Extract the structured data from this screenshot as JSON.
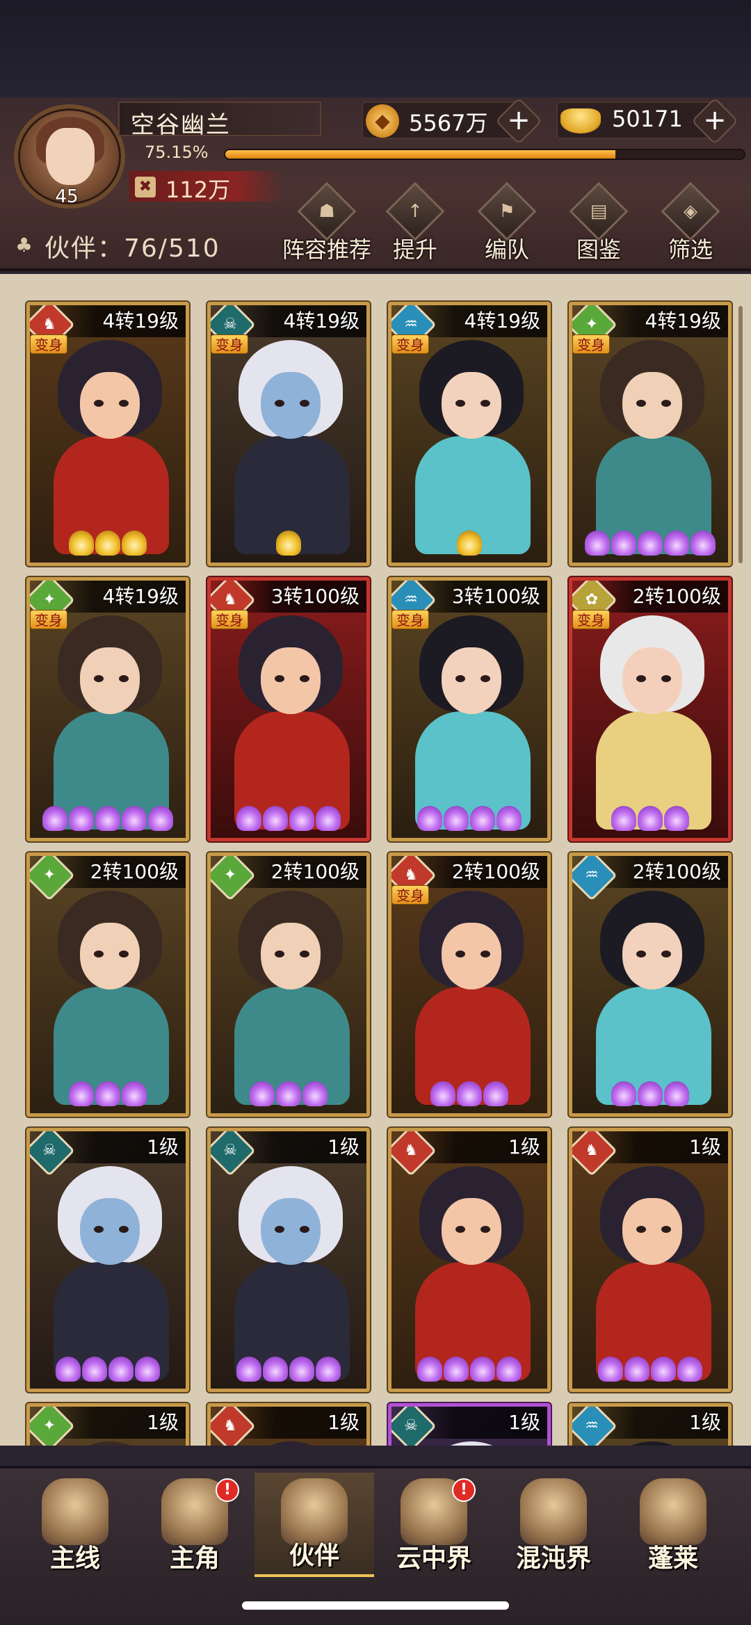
{
  "player": {
    "name": "空谷幽兰",
    "level": "45",
    "exp_percent": "75.15%",
    "exp_fraction": 0.7515,
    "power": "112万"
  },
  "currency": {
    "coins": "5567万",
    "ingots": "50171"
  },
  "partners": {
    "count_label": "伙伴：76/510"
  },
  "toolbar": [
    {
      "label": "阵容推荐",
      "icon": "lineup-recommend-icon"
    },
    {
      "label": "提升",
      "icon": "upgrade-arrow-icon"
    },
    {
      "label": "编队",
      "icon": "formation-flag-icon"
    },
    {
      "label": "图鉴",
      "icon": "scroll-codex-icon"
    },
    {
      "label": "筛选",
      "icon": "filter-icon"
    }
  ],
  "transform_tag": "变身",
  "cards": [
    {
      "level": "4转19级",
      "element": "fire",
      "transform": true,
      "frame": "gold",
      "stars": 3,
      "star_color": "gold"
    },
    {
      "level": "4转19级",
      "element": "dark",
      "transform": true,
      "frame": "gold",
      "stars": 1,
      "star_color": "gold"
    },
    {
      "level": "4转19级",
      "element": "water",
      "transform": true,
      "frame": "gold",
      "stars": 1,
      "star_color": "gold"
    },
    {
      "level": "4转19级",
      "element": "wind",
      "transform": true,
      "frame": "gold",
      "stars": 5,
      "star_color": "purple"
    },
    {
      "level": "4转19级",
      "element": "wind",
      "transform": true,
      "frame": "gold",
      "stars": 5,
      "star_color": "purple"
    },
    {
      "level": "3转100级",
      "element": "fire",
      "transform": true,
      "frame": "red",
      "stars": 4,
      "star_color": "purple"
    },
    {
      "level": "3转100级",
      "element": "water",
      "transform": true,
      "frame": "gold",
      "stars": 4,
      "star_color": "purple"
    },
    {
      "level": "2转100级",
      "element": "light",
      "transform": true,
      "frame": "red",
      "stars": 3,
      "star_color": "purple"
    },
    {
      "level": "2转100级",
      "element": "wind",
      "transform": false,
      "frame": "gold",
      "stars": 3,
      "star_color": "purple"
    },
    {
      "level": "2转100级",
      "element": "wind",
      "transform": false,
      "frame": "gold",
      "stars": 3,
      "star_color": "purple"
    },
    {
      "level": "2转100级",
      "element": "fire",
      "transform": true,
      "frame": "gold",
      "stars": 3,
      "star_color": "purple"
    },
    {
      "level": "2转100级",
      "element": "water",
      "transform": false,
      "frame": "gold",
      "stars": 3,
      "star_color": "purple"
    },
    {
      "level": "1级",
      "element": "dark",
      "transform": false,
      "frame": "gold",
      "stars": 4,
      "star_color": "purple"
    },
    {
      "level": "1级",
      "element": "dark",
      "transform": false,
      "frame": "gold",
      "stars": 4,
      "star_color": "purple"
    },
    {
      "level": "1级",
      "element": "fire",
      "transform": false,
      "frame": "gold",
      "stars": 4,
      "star_color": "purple"
    },
    {
      "level": "1级",
      "element": "fire",
      "transform": false,
      "frame": "gold",
      "stars": 4,
      "star_color": "purple"
    },
    {
      "level": "1级",
      "element": "wind",
      "transform": false,
      "frame": "gold",
      "stars": 0,
      "star_color": "purple"
    },
    {
      "level": "1级",
      "element": "fire",
      "transform": false,
      "frame": "gold",
      "stars": 0,
      "star_color": "purple"
    },
    {
      "level": "1级",
      "element": "dark",
      "transform": false,
      "frame": "purple",
      "stars": 0,
      "star_color": "purple"
    },
    {
      "level": "1级",
      "element": "water",
      "transform": false,
      "frame": "gold",
      "stars": 0,
      "star_color": "purple"
    }
  ],
  "bottom_nav": [
    {
      "label": "主线",
      "icon": "main-quest-icon",
      "badge": ""
    },
    {
      "label": "主角",
      "icon": "hero-icon",
      "badge": "!"
    },
    {
      "label": "伙伴",
      "icon": "partner-icon",
      "badge": "",
      "active": true
    },
    {
      "label": "云中界",
      "icon": "cloud-realm-icon",
      "badge": "!"
    },
    {
      "label": "混沌界",
      "icon": "chaos-realm-icon",
      "badge": ""
    },
    {
      "label": "蓬莱",
      "icon": "penglai-icon",
      "badge": ""
    }
  ],
  "colors": {
    "element_fire": "#c0392b",
    "element_dark": "#1f6a6a",
    "element_water": "#2a8fb8",
    "element_wind": "#5aa83a",
    "element_light": "#b8a23a",
    "frame_gold": "#c89b4a",
    "frame_red": "#c6362e",
    "frame_purple": "#b052d2",
    "exp_bar": "#f0a02a"
  }
}
